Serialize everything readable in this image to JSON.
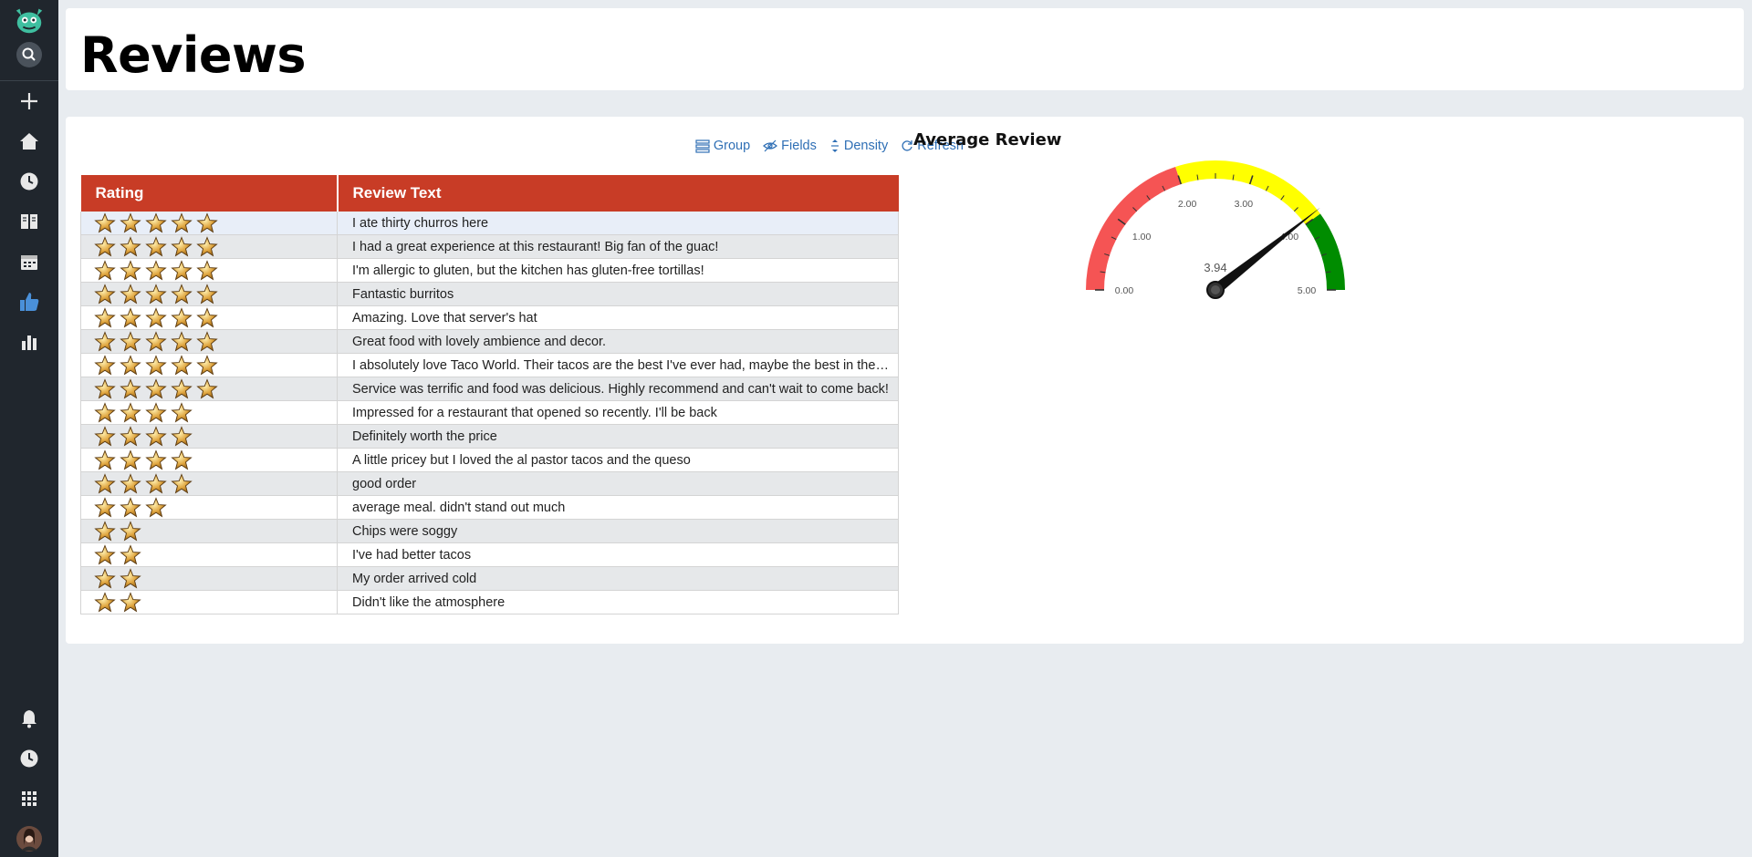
{
  "sidebar": {
    "items": [
      {
        "name": "logo-icon"
      },
      {
        "name": "search-icon"
      },
      {
        "name": "plus-icon"
      },
      {
        "name": "home-icon"
      },
      {
        "name": "history-icon"
      },
      {
        "name": "book-icon"
      },
      {
        "name": "calendar-icon"
      },
      {
        "name": "thumbs-up-icon",
        "active": true
      },
      {
        "name": "bar-chart-icon"
      },
      {
        "name": "bell-icon"
      },
      {
        "name": "clock-icon"
      },
      {
        "name": "grid-icon"
      },
      {
        "name": "avatar"
      }
    ]
  },
  "page": {
    "title": "Reviews"
  },
  "toolbar": {
    "group_label": "Group",
    "fields_label": "Fields",
    "density_label": "Density",
    "refresh_label": "Refresh"
  },
  "table": {
    "columns": [
      "Rating",
      "Review Text"
    ],
    "rows": [
      {
        "rating": 5,
        "text": "I ate thirty churros here"
      },
      {
        "rating": 5,
        "text": "I had a great experience at this restaurant! Big fan of the guac!"
      },
      {
        "rating": 5,
        "text": "I'm allergic to gluten, but the kitchen has gluten-free tortillas!"
      },
      {
        "rating": 5,
        "text": "Fantastic burritos"
      },
      {
        "rating": 5,
        "text": "Amazing. Love that server's hat"
      },
      {
        "rating": 5,
        "text": "Great food with lovely ambience and decor."
      },
      {
        "rating": 5,
        "text": "I absolutely love Taco World. Their tacos are the best I've ever had, maybe the best in the world!"
      },
      {
        "rating": 5,
        "text": "Service was terrific and food was delicious. Highly recommend and can't wait to come back!"
      },
      {
        "rating": 4,
        "text": "Impressed for a restaurant that opened so recently. I'll be back"
      },
      {
        "rating": 4,
        "text": "Definitely worth the price"
      },
      {
        "rating": 4,
        "text": "A little pricey but I loved the al pastor tacos and the queso"
      },
      {
        "rating": 4,
        "text": "good order"
      },
      {
        "rating": 3,
        "text": "average meal. didn't stand out much"
      },
      {
        "rating": 2,
        "text": "Chips were soggy"
      },
      {
        "rating": 2,
        "text": "I've had better tacos"
      },
      {
        "rating": 2,
        "text": "My order arrived cold"
      },
      {
        "rating": 2,
        "text": "Didn't like the atmosphere"
      }
    ]
  },
  "gauge": {
    "title": "Average Review",
    "value": 3.94,
    "value_label": "3.94",
    "min": 0,
    "max": 5,
    "tick_labels": [
      "0.00",
      "1.00",
      "2.00",
      "3.00",
      "4.00",
      "5.00"
    ],
    "bands": [
      {
        "from": 0,
        "to": 2,
        "color": "#f55454"
      },
      {
        "from": 2,
        "to": 4,
        "color": "#ffff00"
      },
      {
        "from": 4,
        "to": 5,
        "color": "#008c00"
      }
    ]
  },
  "colors": {
    "header_red": "#c83c26",
    "link_blue": "#2f6fb5",
    "sidebar_bg": "#20262d",
    "active_icon": "#4a90d9"
  }
}
